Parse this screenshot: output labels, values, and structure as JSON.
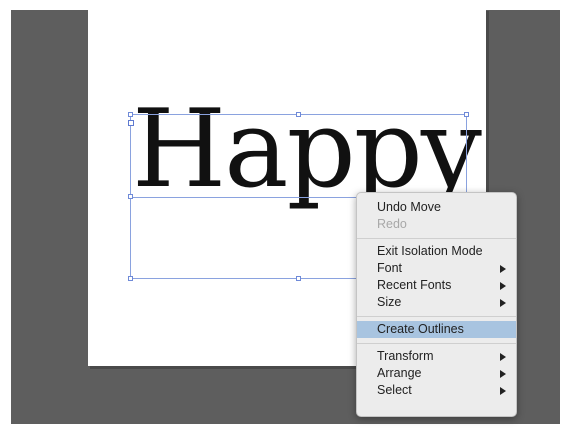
{
  "canvas": {
    "text": "Happy"
  },
  "context_menu": {
    "groups": [
      [
        {
          "label": "Undo Move",
          "enabled": true,
          "submenu": false
        },
        {
          "label": "Redo",
          "enabled": false,
          "submenu": false
        }
      ],
      [
        {
          "label": "Exit Isolation Mode",
          "enabled": true,
          "submenu": false
        },
        {
          "label": "Font",
          "enabled": true,
          "submenu": true
        },
        {
          "label": "Recent Fonts",
          "enabled": true,
          "submenu": true
        },
        {
          "label": "Size",
          "enabled": true,
          "submenu": true
        }
      ],
      [
        {
          "label": "Create Outlines",
          "enabled": true,
          "submenu": false,
          "highlighted": true
        }
      ],
      [
        {
          "label": "Transform",
          "enabled": true,
          "submenu": true
        },
        {
          "label": "Arrange",
          "enabled": true,
          "submenu": true
        },
        {
          "label": "Select",
          "enabled": true,
          "submenu": true
        }
      ]
    ]
  },
  "colors": {
    "pasteboard": "#5e5e5e",
    "page": "#ffffff",
    "selection": "#8aa2df",
    "menu_highlight": "#a8c4e0"
  },
  "icons": [
    "submenu-arrow-icon"
  ]
}
